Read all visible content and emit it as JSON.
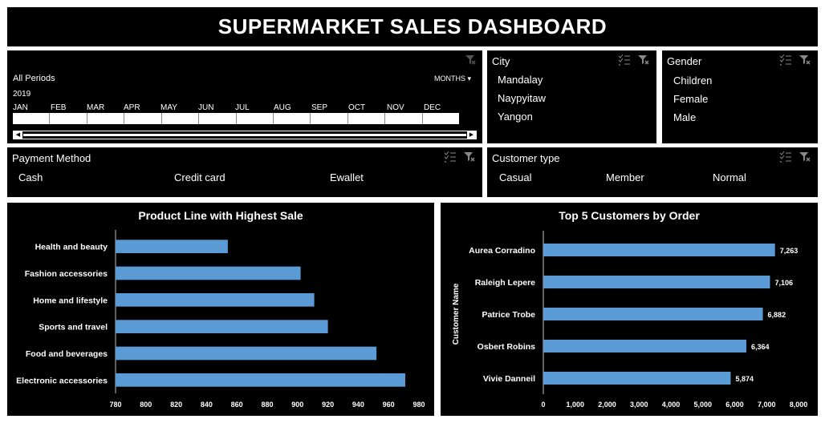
{
  "header": {
    "title": "SUPERMARKET SALES DASHBOARD"
  },
  "timeline": {
    "period_label": "All Periods",
    "year": "2019",
    "level": "MONTHS",
    "months": [
      "JAN",
      "FEB",
      "MAR",
      "APR",
      "MAY",
      "JUN",
      "JUL",
      "AUG",
      "SEP",
      "OCT",
      "NOV",
      "DEC"
    ]
  },
  "city": {
    "title": "City",
    "items": [
      "Mandalay",
      "Naypyitaw",
      "Yangon"
    ]
  },
  "gender": {
    "title": "Gender",
    "items": [
      "Children",
      "Female",
      "Male"
    ]
  },
  "payment": {
    "title": "Payment Method",
    "items": [
      "Cash",
      "Credit card",
      "Ewallet"
    ]
  },
  "customer_type": {
    "title": "Customer type",
    "items": [
      "Casual",
      "Member",
      "Normal"
    ]
  },
  "colors": {
    "bar": "#5b9bd5",
    "panel": "#000000",
    "text": "#ffffff"
  },
  "chart_data": [
    {
      "type": "bar",
      "orientation": "horizontal",
      "title": "Product Line with Highest Sale",
      "categories": [
        "Health and beauty",
        "Fashion accessories",
        "Home and lifestyle",
        "Sports and travel",
        "Food and beverages",
        "Electronic accessories"
      ],
      "values": [
        854,
        902,
        911,
        920,
        952,
        971
      ],
      "xlim": [
        780,
        980
      ],
      "xticks": [
        780,
        800,
        820,
        840,
        860,
        880,
        900,
        920,
        940,
        960,
        980
      ],
      "tick_labels": [
        "780",
        "800",
        "820",
        "840",
        "860",
        "880",
        "900",
        "920",
        "940",
        "960",
        "980"
      ],
      "grid": false
    },
    {
      "type": "bar",
      "orientation": "horizontal",
      "title": "Top 5 Customers by Order",
      "ylabel": "Customer Name",
      "categories": [
        "Aurea Corradino",
        "Raleigh Lepere",
        "Patrice Trobe",
        "Osbert Robins",
        "Vivie Danneil"
      ],
      "values": [
        7263,
        7106,
        6882,
        6364,
        5874
      ],
      "value_labels": [
        "7,263",
        "7,106",
        "6,882",
        "6,364",
        "5,874"
      ],
      "xlim": [
        0,
        8000
      ],
      "xticks": [
        0,
        1000,
        2000,
        3000,
        4000,
        5000,
        6000,
        7000,
        8000
      ],
      "tick_labels": [
        "0",
        "1,000",
        "2,000",
        "3,000",
        "4,000",
        "5,000",
        "6,000",
        "7,000",
        "8,000"
      ],
      "grid": false
    }
  ]
}
